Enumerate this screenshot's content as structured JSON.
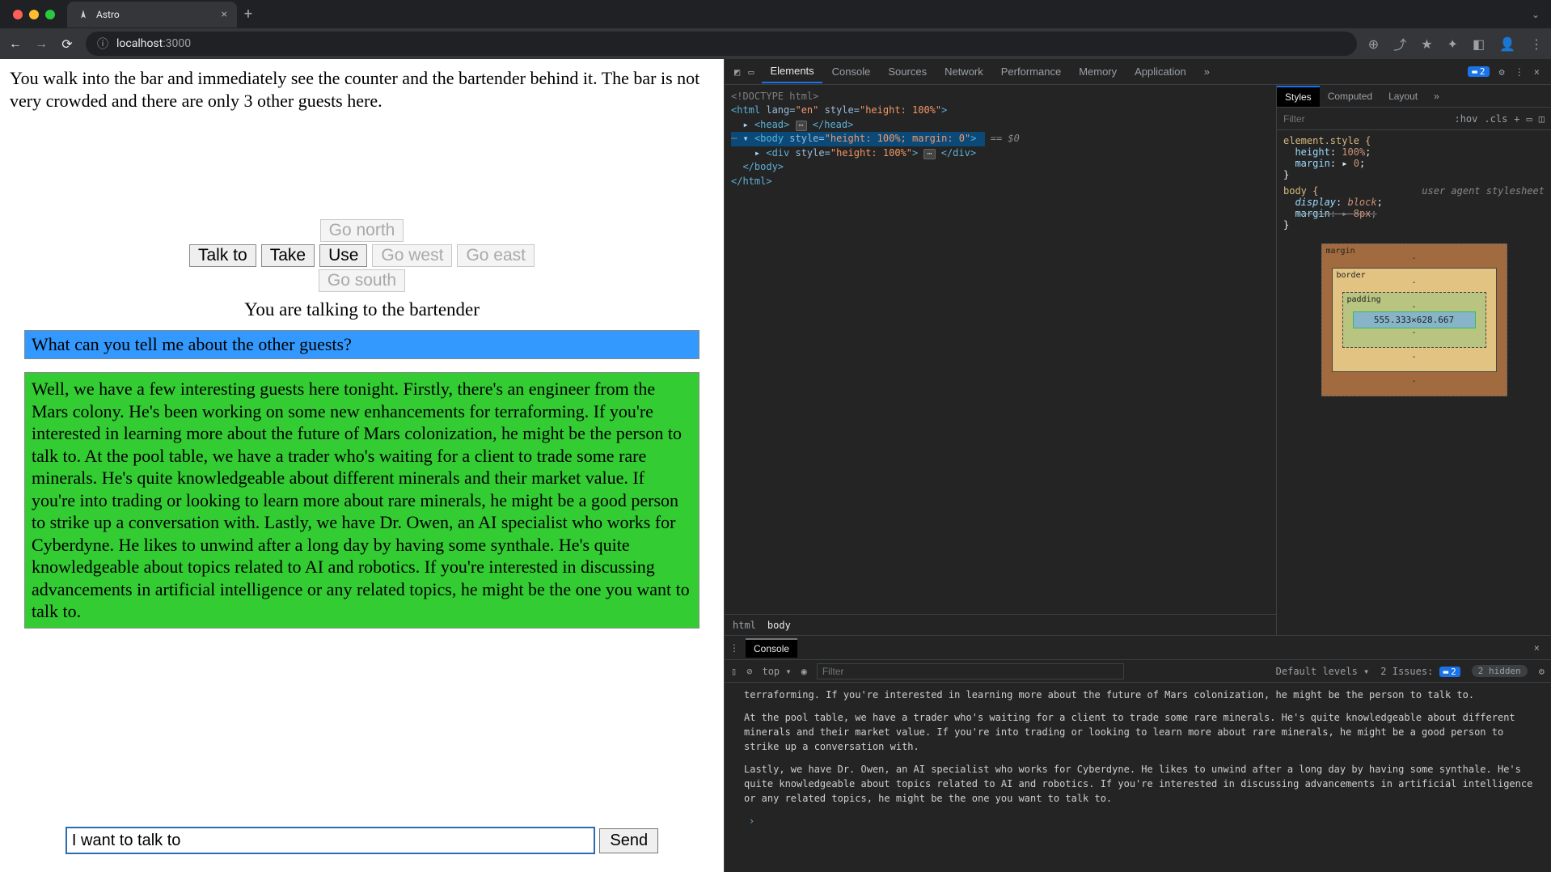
{
  "browser": {
    "tab_title": "Astro",
    "url_host": "localhost",
    "url_port": ":3000",
    "traffic": [
      "red",
      "yellow",
      "green"
    ]
  },
  "game": {
    "narration": "You walk into the bar and immediately see the counter and the bartender behind it. The bar is not very crowded and there are only 3 other guests here.",
    "buttons": {
      "talk": "Talk to",
      "take": "Take",
      "use": "Use",
      "north": "Go north",
      "south": "Go south",
      "east": "Go east",
      "west": "Go west"
    },
    "talking_to": "You are talking to the bartender",
    "user_msg": "What can you tell me about the other guests?",
    "npc_msg": "Well, we have a few interesting guests here tonight. Firstly, there's an engineer from the Mars colony. He's been working on some new enhancements for terraforming. If you're interested in learning more about the future of Mars colonization, he might be the person to talk to. At the pool table, we have a trader who's waiting for a client to trade some rare minerals. He's quite knowledgeable about different minerals and their market value. If you're into trading or looking to learn more about rare minerals, he might be a good person to strike up a conversation with. Lastly, we have Dr. Owen, an AI specialist who works for Cyberdyne. He likes to unwind after a long day by having some synthale. He's quite knowledgeable about topics related to AI and robotics. If you're interested in discussing advancements in artificial intelligence or any related topics, he might be the one you want to talk to.",
    "input_value": "I want to talk to ",
    "send_label": "Send"
  },
  "devtools": {
    "tabs": [
      "Elements",
      "Console",
      "Sources",
      "Network",
      "Performance",
      "Memory",
      "Application"
    ],
    "active_tab": "Elements",
    "issues_count": "2",
    "dom": {
      "l1": "<!DOCTYPE html>",
      "l2a": "<html ",
      "l2b": "lang=",
      "l2c": "\"en\"",
      "l2d": " style=",
      "l2e": "\"height: 100%\"",
      "l2f": ">",
      "l3a": "<head>",
      "l3b": "</head>",
      "l4a": "<body ",
      "l4b": "style=",
      "l4c": "\"height: 100%; margin: 0\"",
      "l4d": ">",
      "l4e": " == $0",
      "l5a": "<div ",
      "l5b": "style=",
      "l5c": "\"height: 100%\"",
      "l5d": ">",
      "l5e": "</div>",
      "l6": "</body>",
      "l7": "</html>"
    },
    "styles": {
      "tabs": [
        "Styles",
        "Computed",
        "Layout"
      ],
      "filter_ph": "Filter",
      "hov": ":hov",
      "cls": ".cls",
      "rule1_sel": "element.style {",
      "rule1_p1": "height",
      "rule1_v1": "100%",
      "rule1_p2": "margin",
      "rule1_v2": "0",
      "rule2_sel": "body {",
      "rule2_src": "user agent stylesheet",
      "rule2_p1": "display",
      "rule2_v1": "block",
      "rule2_p2": "margin",
      "rule2_v2": "8px",
      "box": {
        "margin": "margin",
        "border": "border",
        "padding": "padding",
        "dims": "555.333×628.667"
      }
    },
    "crumbs": {
      "c1": "html",
      "c2": "body"
    },
    "console": {
      "tab": "Console",
      "ctx": "top",
      "filter_ph": "Filter",
      "levels": "Default levels",
      "issues_label": "2 Issues:",
      "issues_n": "2",
      "hidden": "2 hidden",
      "p1": "terraforming. If you're interested in learning more about the future of Mars colonization, he might be the person to talk to.",
      "p2": "At the pool table, we have a trader who's waiting for a client to trade some rare minerals. He's quite knowledgeable about different minerals and their market value. If you're into trading or looking to learn more about rare minerals, he might be a good person to strike up a conversation with.",
      "p3": "Lastly, we have Dr. Owen, an AI specialist who works for Cyberdyne. He likes to unwind after a long day by having some synthale. He's quite knowledgeable about topics related to AI and robotics. If you're interested in discussing advancements in artificial intelligence or any related topics, he might be the one you want to talk to."
    }
  }
}
